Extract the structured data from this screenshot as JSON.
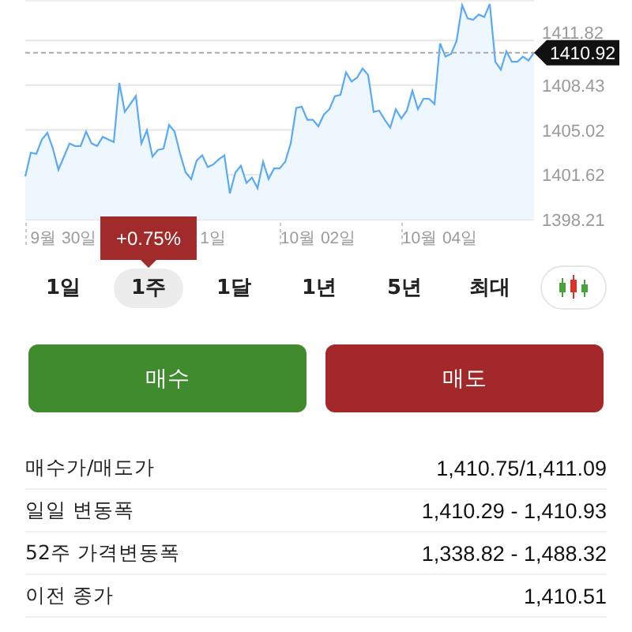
{
  "chart": {
    "chart_data": {
      "type": "area",
      "grid": true,
      "ylim": [
        1398.21,
        1414.9
      ],
      "categories": [
        null,
        null,
        null,
        null,
        null,
        null,
        null,
        "9월 30일",
        null,
        null,
        null,
        null,
        null,
        null,
        null,
        null,
        null,
        null,
        null,
        null,
        null,
        null,
        null,
        null,
        null,
        null,
        null,
        null,
        null,
        null,
        null,
        null,
        null,
        null,
        "1일",
        null,
        null,
        null,
        null,
        null,
        null,
        null,
        null,
        null,
        null,
        null,
        null,
        null,
        null,
        null,
        null,
        null,
        null,
        "10월 02일",
        null,
        null,
        null,
        null,
        null,
        null,
        null,
        null,
        null,
        null,
        null,
        null,
        null,
        null,
        null,
        null,
        null,
        null,
        null,
        null,
        null,
        "10월 04일",
        null,
        null,
        null,
        null,
        null,
        null,
        null,
        null,
        null,
        null,
        null,
        null,
        null,
        null,
        null,
        null,
        null
      ],
      "yticks": [
        1398.21,
        1401.62,
        1405.02,
        1408.43,
        1411.82
      ],
      "series": [
        {
          "color": "#5aa9f5",
          "values": [
            1401.5,
            1403.3,
            1403.2,
            1404.3,
            1404.8,
            1403.6,
            1402.0,
            1403.0,
            1404.0,
            1403.8,
            1403.8,
            1404.9,
            1404.0,
            1403.8,
            1404.5,
            1404.3,
            1404.1,
            1408.6,
            1406.4,
            1407.0,
            1407.6,
            1404.0,
            1405.0,
            1403.0,
            1403.5,
            1403.6,
            1405.4,
            1404.9,
            1403.2,
            1401.8,
            1401.3,
            1402.7,
            1403.1,
            1402.2,
            1402.4,
            1402.8,
            1403.1,
            1400.2,
            1401.8,
            1402.3,
            1401.0,
            1401.4,
            1400.6,
            1402.6,
            1401.3,
            1402.1,
            1402.1,
            1402.6,
            1404.0,
            1406.7,
            1406.8,
            1405.8,
            1405.8,
            1405.3,
            1406.2,
            1406.6,
            1407.6,
            1407.7,
            1409.4,
            1408.7,
            1409.0,
            1409.7,
            1409.2,
            1406.4,
            1406.5,
            1405.8,
            1405.2,
            1406.6,
            1405.9,
            1406.5,
            1408.0,
            1406.6,
            1407.4,
            1407.4,
            1407.0,
            1411.6,
            1410.6,
            1410.8,
            1411.8,
            1414.5,
            1413.5,
            1413.4,
            1413.8,
            1413.6,
            1414.6,
            1410.2,
            1409.6,
            1411.0,
            1410.2,
            1410.2,
            1410.6,
            1410.3,
            1410.9
          ]
        }
      ]
    },
    "current_price": "1410.92"
  },
  "periods": {
    "change_badge": "+0.75%",
    "tabs": [
      {
        "label": "1일",
        "selected": false
      },
      {
        "label": "1주",
        "selected": true
      },
      {
        "label": "1달",
        "selected": false
      },
      {
        "label": "1년",
        "selected": false
      },
      {
        "label": "5년",
        "selected": false
      },
      {
        "label": "최대",
        "selected": false
      }
    ]
  },
  "actions": [
    {
      "label": "매수",
      "kind": "buy"
    },
    {
      "label": "매도",
      "kind": "sell"
    }
  ],
  "stats": [
    {
      "label": "매수가/매도가",
      "value": "1,410.75/1,411.09"
    },
    {
      "label": "일일 변동폭",
      "value": "1,410.29 - 1,410.93"
    },
    {
      "label": "52주 가격변동폭",
      "value": "1,338.82 - 1,488.32"
    },
    {
      "label": "이전 종가",
      "value": "1,410.51"
    }
  ]
}
